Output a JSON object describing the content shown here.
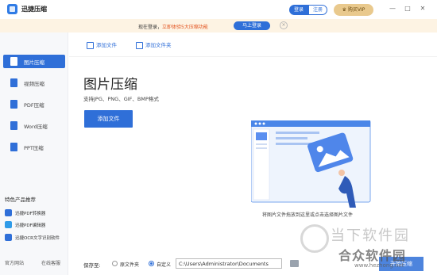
{
  "app": {
    "title": "迅捷压缩",
    "login": "登录",
    "register": "注册",
    "vip": "购买VIP",
    "minimize": "—",
    "maximize": "□",
    "close": "✕"
  },
  "banner": {
    "text_prefix": "现在登录，",
    "text_highlight": "立即体验5大压缩功能",
    "button": "马上登录",
    "close": "×"
  },
  "sidebar": {
    "items": [
      {
        "label": "图片压缩",
        "icon": "image-icon",
        "color": "#2f6fd8"
      },
      {
        "label": "视频压缩",
        "icon": "video-icon",
        "color": "#2f6fd8"
      },
      {
        "label": "PDF压缩",
        "icon": "pdf-icon",
        "color": "#2f6fd8"
      },
      {
        "label": "Word压缩",
        "icon": "word-icon",
        "color": "#2f6fd8"
      },
      {
        "label": "PPT压缩",
        "icon": "ppt-icon",
        "color": "#2f6fd8"
      }
    ],
    "recommend_title": "特色产品推荐",
    "recommend": [
      {
        "label": "迅捷PDF转换器",
        "icon": "pdf-converter-icon",
        "color": "#2f6fd8"
      },
      {
        "label": "迅捷PDF编辑器",
        "icon": "pdf-editor-icon",
        "color": "#2f9be8"
      },
      {
        "label": "迅捷OCR文字识别软件",
        "icon": "ocr-icon",
        "color": "#2f6fd8"
      }
    ],
    "footer": {
      "website": "官方网站",
      "support": "在线客服"
    }
  },
  "main": {
    "toolbar": {
      "add_file": "添加文件",
      "add_folder": "添加文件夹"
    },
    "heading": "图片压缩",
    "formats": "支持JPG、PNG、GIF、BMP格式",
    "add_button": "添加文件",
    "drop_hint": "将图片文件拖放到这里或点击选择图片文件",
    "accent": "#2f6fd8"
  },
  "bottom": {
    "save_to": "保存至:",
    "option_original": "原文件夹",
    "option_custom": "自定义",
    "path": "C:\\Users\\Administrator\\Documents",
    "start": "开始压缩"
  },
  "watermark": {
    "line1": "当下软件园",
    "line2": "合众软件园",
    "line3": "www.hezhong.net"
  }
}
